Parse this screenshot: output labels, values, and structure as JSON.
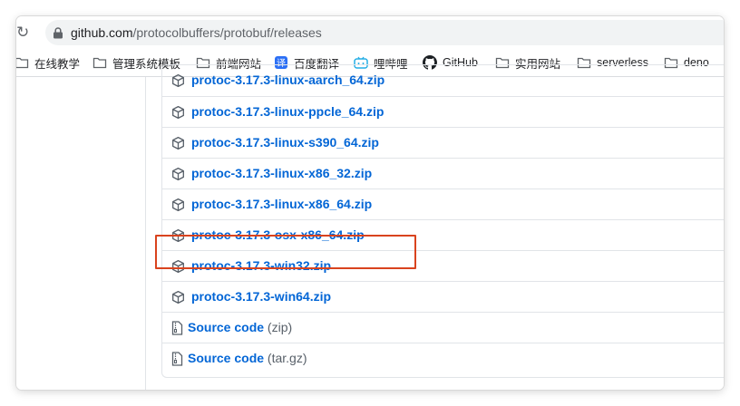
{
  "browser": {
    "url_host": "github.com",
    "url_path": "/protocolbuffers/protobuf/releases",
    "bookmarks": [
      {
        "label": "在线教学",
        "icon": "folder-icon"
      },
      {
        "label": "管理系统模板",
        "icon": "folder-icon"
      },
      {
        "label": "前端网站",
        "icon": "folder-icon"
      },
      {
        "label": "百度翻译",
        "icon": "baidu-translate-icon"
      },
      {
        "label": "哩哔哩",
        "icon": "bilibili-icon"
      },
      {
        "label": "GitHub",
        "icon": "github-icon"
      },
      {
        "label": "实用网站",
        "icon": "folder-icon"
      },
      {
        "label": "serverless",
        "icon": "folder-icon"
      },
      {
        "label": "deno",
        "icon": "folder-icon"
      }
    ]
  },
  "assets": [
    {
      "name": "protoc-3.17.3-linux-aarch_64.zip",
      "icon": "package-icon"
    },
    {
      "name": "protoc-3.17.3-linux-ppcle_64.zip",
      "icon": "package-icon"
    },
    {
      "name": "protoc-3.17.3-linux-s390_64.zip",
      "icon": "package-icon"
    },
    {
      "name": "protoc-3.17.3-linux-x86_32.zip",
      "icon": "package-icon"
    },
    {
      "name": "protoc-3.17.3-linux-x86_64.zip",
      "icon": "package-icon"
    },
    {
      "name": "protoc-3.17.3-osx-x86_64.zip",
      "icon": "package-icon",
      "highlighted": true
    },
    {
      "name": "protoc-3.17.3-win32.zip",
      "icon": "package-icon"
    },
    {
      "name": "protoc-3.17.3-win64.zip",
      "icon": "package-icon"
    }
  ],
  "source_code": [
    {
      "label": "Source code",
      "ext": "(zip)",
      "icon": "file-zip-icon"
    },
    {
      "label": "Source code",
      "ext": "(tar.gz)",
      "icon": "file-zip-icon"
    }
  ],
  "colors": {
    "link": "#0366d6",
    "highlight_box": "#d9431e"
  }
}
